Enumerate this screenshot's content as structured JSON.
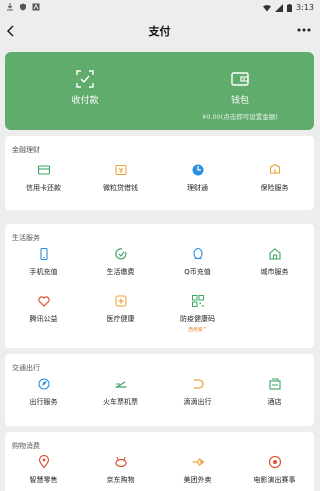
{
  "status_bar": {
    "time": "3:13",
    "left_icons": [
      "download-icon",
      "shield-icon",
      "font-icon"
    ]
  },
  "nav": {
    "title": "支付",
    "back_label": "back",
    "more_label": "more"
  },
  "wallet_card": {
    "pay": {
      "label": "收付款",
      "icon": "scan-pay-icon"
    },
    "wallet": {
      "label": "钱包",
      "sub": "¥0.00(点击即可设置金额)",
      "icon": "wallet-icon"
    }
  },
  "sections": [
    {
      "title": "金融理财",
      "items": [
        {
          "label": "信用卡还款",
          "icon": "credit-card-icon",
          "color": "#3ba565"
        },
        {
          "label": "微粒贷借钱",
          "icon": "loan-icon",
          "color": "#e9a23b"
        },
        {
          "label": "理财通",
          "icon": "wealth-icon",
          "color": "#2b8ee0"
        },
        {
          "label": "保险服务",
          "icon": "insurance-icon",
          "color": "#e9a23b"
        }
      ]
    },
    {
      "title": "生活服务",
      "items": [
        {
          "label": "手机充值",
          "icon": "mobile-topup-icon",
          "color": "#2b8ee0"
        },
        {
          "label": "生活缴费",
          "icon": "utility-icon",
          "color": "#3ba565"
        },
        {
          "label": "Q币充值",
          "icon": "qcoin-icon",
          "color": "#2b8ee0"
        },
        {
          "label": "城市服务",
          "icon": "city-icon",
          "color": "#3ba565"
        },
        {
          "label": "腾讯公益",
          "icon": "charity-icon",
          "color": "#e0533a"
        },
        {
          "label": "医疗健康",
          "icon": "medical-icon",
          "color": "#e9a23b"
        },
        {
          "label": "防疫健康码",
          "icon": "health-code-icon",
          "color": "#3ba565",
          "tag": "西经家^"
        }
      ]
    },
    {
      "title": "交通出行",
      "items": [
        {
          "label": "出行服务",
          "icon": "travel-icon",
          "color": "#2b8ee0"
        },
        {
          "label": "火车票机票",
          "icon": "train-icon",
          "color": "#3ba565"
        },
        {
          "label": "滴滴出行",
          "icon": "didi-icon",
          "color": "#e9a23b"
        },
        {
          "label": "酒店",
          "icon": "hotel-icon",
          "color": "#3ba565"
        }
      ]
    },
    {
      "title": "购物消费",
      "items": [
        {
          "label": "智慧零售",
          "icon": "retail-icon",
          "color": "#e0533a"
        },
        {
          "label": "京东购物",
          "icon": "jd-icon",
          "color": "#e0533a"
        },
        {
          "label": "美团外卖",
          "icon": "meituan-icon",
          "color": "#e9a23b"
        },
        {
          "label": "电影演出赛事",
          "icon": "movie-icon",
          "color": "#e0533a"
        }
      ]
    }
  ]
}
